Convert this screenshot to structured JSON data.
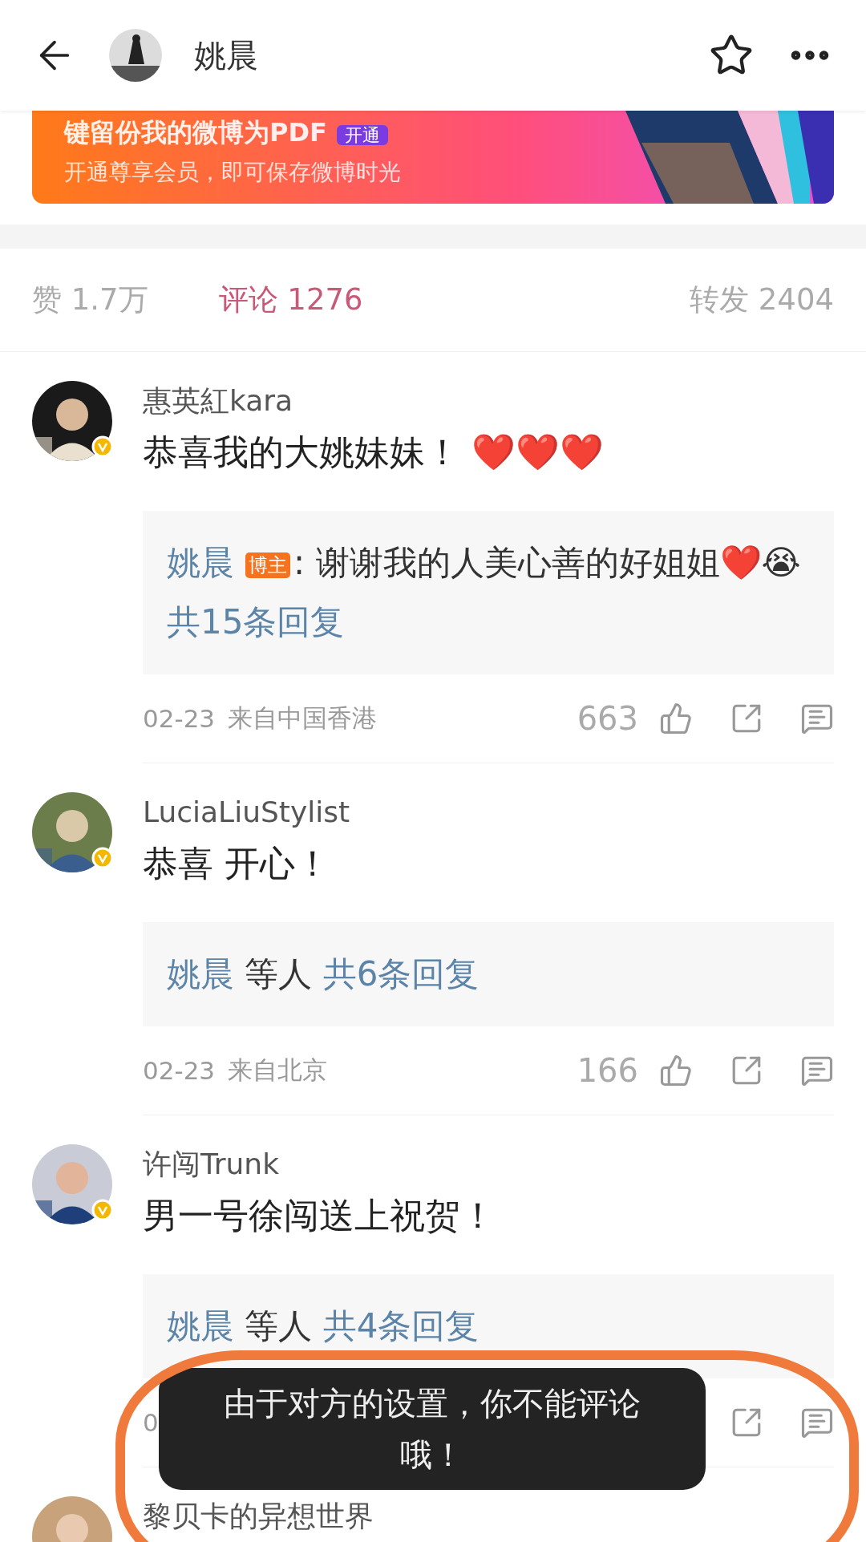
{
  "header": {
    "title": "姚晨"
  },
  "banner": {
    "title": "键留份我的微博为PDF",
    "badge": "开通",
    "subtitle": "开通尊享会员，即可保存微博时光"
  },
  "stats": [
    {
      "label": "赞 1.7万",
      "selected": false
    },
    {
      "label": "评论 1276",
      "selected": true
    },
    {
      "label": "转发 2404",
      "selected": false
    }
  ],
  "comments": [
    {
      "name": "惠英紅kara",
      "text": "恭喜我的大姚妹妹！ ❤️❤️❤️",
      "verified": true,
      "reply": {
        "kind": "quote",
        "author": "姚晨",
        "badge": "博主",
        "text": ": 谢谢我的人美心善的好姐姐❤️😭",
        "more": "共15条回复"
      },
      "footer": {
        "date": "02-23",
        "location": "来自中国香港",
        "likes": "663"
      }
    },
    {
      "name": "LuciaLiuStylist",
      "text": "恭喜 开心！",
      "verified": true,
      "reply": {
        "kind": "summary",
        "author": "姚晨",
        "suffix": "等人",
        "more": "共6条回复"
      },
      "footer": {
        "date": "02-23",
        "location": "来自北京",
        "likes": "166"
      }
    },
    {
      "name": "许闯Trunk",
      "text": "男一号徐闯送上祝贺！",
      "verified": true,
      "reply": {
        "kind": "summary",
        "author": "姚晨",
        "suffix": "等人",
        "more": "共4条回复"
      },
      "footer": {
        "date": "0"
      }
    },
    {
      "name": "黎贝卡的异想世界"
    }
  ],
  "toast": {
    "text": "由于对方的设置，你不能评论哦！"
  }
}
